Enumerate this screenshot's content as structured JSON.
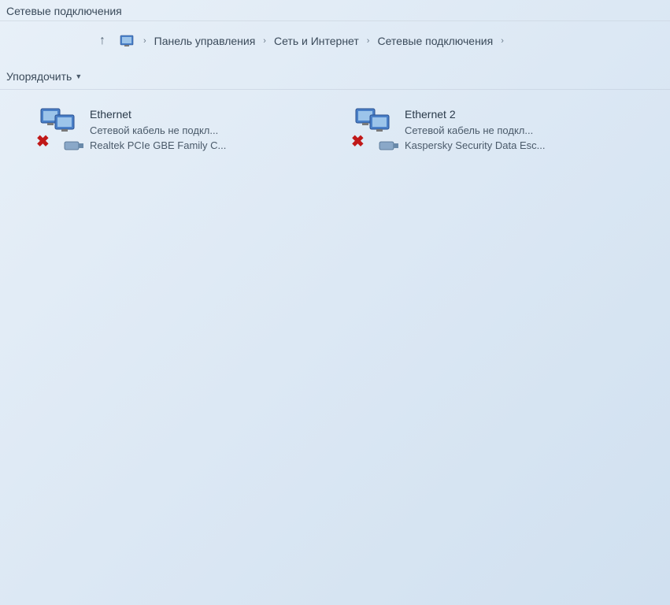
{
  "window": {
    "title": "Сетевые подключения"
  },
  "breadcrumb": {
    "items": [
      "Панель управления",
      "Сеть и Интернет",
      "Сетевые подключения"
    ]
  },
  "toolbar": {
    "organize_label": "Упорядочить"
  },
  "connections": [
    {
      "name": "Ethernet",
      "status": "Сетевой кабель не подкл...",
      "device": "Realtek PCIe GBE Family C..."
    },
    {
      "name": "Ethernet 2",
      "status": "Сетевой кабель не подкл...",
      "device": "Kaspersky Security Data Esc..."
    }
  ]
}
